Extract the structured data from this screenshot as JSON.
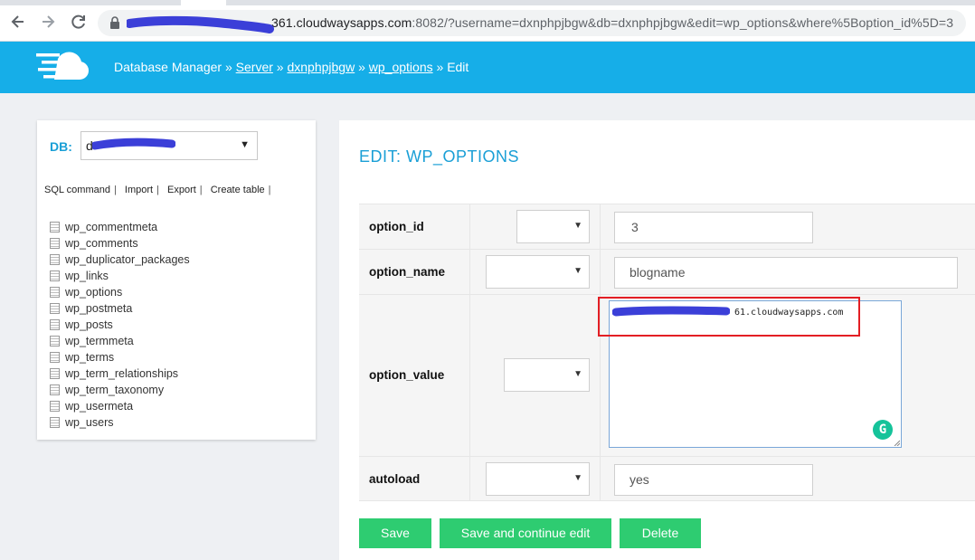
{
  "browser": {
    "url_host": "361.cloudwaysapps.com",
    "url_rest": ":8082/?username=dxnphpjbgw&db=dxnphpjbgw&edit=wp_options&where%5Boption_id%5D=3"
  },
  "header": {
    "app_title": "Database Manager",
    "separator": "»",
    "crumb_server": "Server",
    "crumb_db": "dxnphpjbgw",
    "crumb_table": "wp_options",
    "crumb_current": "Edit"
  },
  "sidebar": {
    "db_label": "DB:",
    "db_value": "d",
    "commands": [
      "SQL command",
      "Import",
      "Export",
      "Create table"
    ],
    "tables": [
      "wp_commentmeta",
      "wp_comments",
      "wp_duplicator_packages",
      "wp_links",
      "wp_options",
      "wp_postmeta",
      "wp_posts",
      "wp_termmeta",
      "wp_terms",
      "wp_term_relationships",
      "wp_term_taxonomy",
      "wp_usermeta",
      "wp_users"
    ]
  },
  "main": {
    "title": "EDIT: WP_OPTIONS",
    "fields": [
      {
        "name": "option_id",
        "value": "3"
      },
      {
        "name": "option_name",
        "value": "blogname"
      },
      {
        "name": "option_value",
        "value": "61.cloudwaysapps.com"
      },
      {
        "name": "autoload",
        "value": "yes"
      }
    ],
    "buttons": {
      "save": "Save",
      "save_continue": "Save and continue edit",
      "delete": "Delete"
    }
  },
  "colors": {
    "header": "#16aee8",
    "accent": "#1a9fd6",
    "button": "#2ecc71",
    "highlight": "#e31e24",
    "redaction": "#3b3fd8"
  }
}
